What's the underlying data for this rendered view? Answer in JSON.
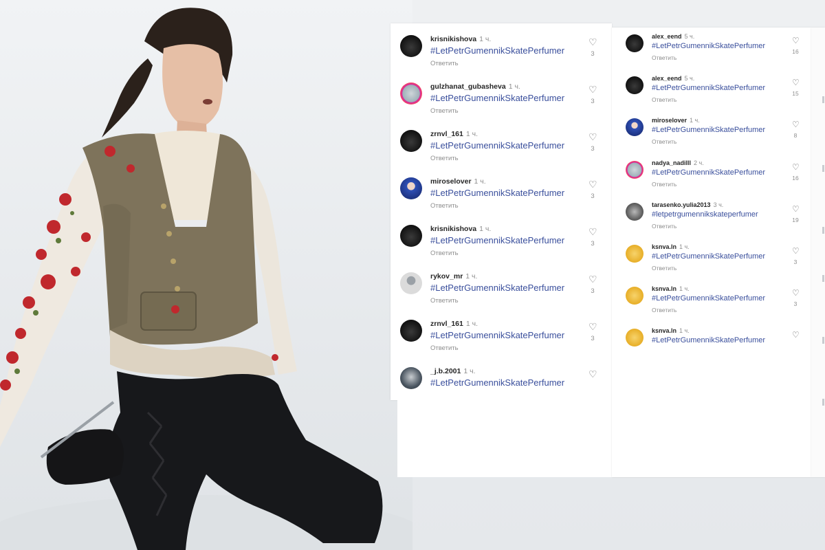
{
  "colors": {
    "hashtag": "#3a4f9c",
    "username": "#262626",
    "muted": "#8e8e8e",
    "panel": "#ffffff",
    "ice": "#e9ecef"
  },
  "comments_left": [
    {
      "username": "krisnikishova",
      "time": "1 ч.",
      "text": "#LetPetrGumennikSkatePerfumer",
      "reply": "Ответить",
      "likes": "3",
      "avatar": "dark"
    },
    {
      "username": "gulzhanat_gubasheva",
      "time": "1 ч.",
      "text": "#LetPetrGumennikSkatePerfumer",
      "reply": "Ответить",
      "likes": "3",
      "avatar": "story-ring"
    },
    {
      "username": "zrnvl_161",
      "time": "1 ч.",
      "text": "#LetPetrGumennikSkatePerfumer",
      "reply": "Ответить",
      "likes": "3",
      "avatar": "dark"
    },
    {
      "username": "miroselover",
      "time": "1 ч.",
      "text": "#LetPetrGumennikSkatePerfumer",
      "reply": "Ответить",
      "likes": "3",
      "avatar": "blue"
    },
    {
      "username": "krisnikishova",
      "time": "1 ч.",
      "text": "#LetPetrGumennikSkatePerfumer",
      "reply": "Ответить",
      "likes": "3",
      "avatar": "dark"
    },
    {
      "username": "rykov_mr",
      "time": "1 ч.",
      "text": "#LetPetrGumennikSkatePerfumer",
      "reply": "Ответить",
      "likes": "3",
      "avatar": "default"
    },
    {
      "username": "zrnvl_161",
      "time": "1 ч.",
      "text": "#LetPetrGumennikSkatePerfumer",
      "reply": "Ответить",
      "likes": "3",
      "avatar": "dark"
    },
    {
      "username": "_j.b.2001",
      "time": "1 ч.",
      "text": "#LetPetrGumennikSkatePerfumer",
      "reply": "",
      "likes": "",
      "avatar": "photo"
    }
  ],
  "comments_right": [
    {
      "username": "alex_eend",
      "time": "5 ч.",
      "text": "#LetPetrGumennikSkatePerfumer",
      "reply": "Ответить",
      "likes": "16",
      "avatar": "dark"
    },
    {
      "username": "alex_eend",
      "time": "5 ч.",
      "text": "#LetPetrGumennikSkatePerfumer",
      "reply": "Ответить",
      "likes": "15",
      "avatar": "dark"
    },
    {
      "username": "miroselover",
      "time": "1 ч.",
      "text": "#LetPetrGumennikSkatePerfumer",
      "reply": "Ответить",
      "likes": "8",
      "avatar": "blue"
    },
    {
      "username": "nadya_nadilll",
      "time": "2 ч.",
      "text": "#LetPetrGumennikSkatePerfumer",
      "reply": "Ответить",
      "likes": "16",
      "avatar": "story-ring"
    },
    {
      "username": "tarasenko.yulia2013",
      "time": "3 ч.",
      "text": "#letpetrgumennikskateperfumer",
      "reply": "Ответить",
      "likes": "19",
      "avatar": "gray"
    },
    {
      "username": "ksnva.ln",
      "time": "1 ч.",
      "text": "#LetPetrGumennikSkatePerfumer",
      "reply": "Ответить",
      "likes": "3",
      "avatar": "yellow"
    },
    {
      "username": "ksnva.ln",
      "time": "1 ч.",
      "text": "#LetPetrGumennikSkatePerfumer",
      "reply": "Ответить",
      "likes": "3",
      "avatar": "yellow"
    },
    {
      "username": "ksnva.ln",
      "time": "1 ч.",
      "text": "#LetPetrGumennikSkatePerfumer",
      "reply": "",
      "likes": "",
      "avatar": "yellow"
    }
  ]
}
